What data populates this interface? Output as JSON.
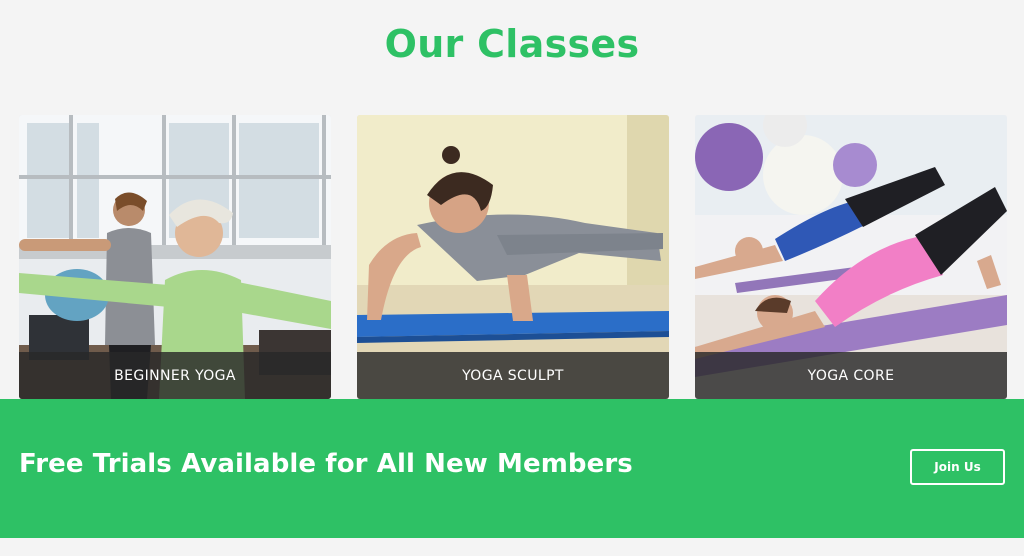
{
  "section": {
    "title": "Our Classes",
    "accent_color": "#2ec165"
  },
  "classes": [
    {
      "label": "BEGINNER YOGA",
      "image": "beginner-yoga-photo"
    },
    {
      "label": "YOGA SCULPT",
      "image": "yoga-sculpt-photo"
    },
    {
      "label": "YOGA CORE",
      "image": "yoga-core-photo"
    }
  ],
  "banner": {
    "text": "Free Trials Available for All New Members",
    "button_label": "Join Us",
    "background": "#2ec165"
  }
}
